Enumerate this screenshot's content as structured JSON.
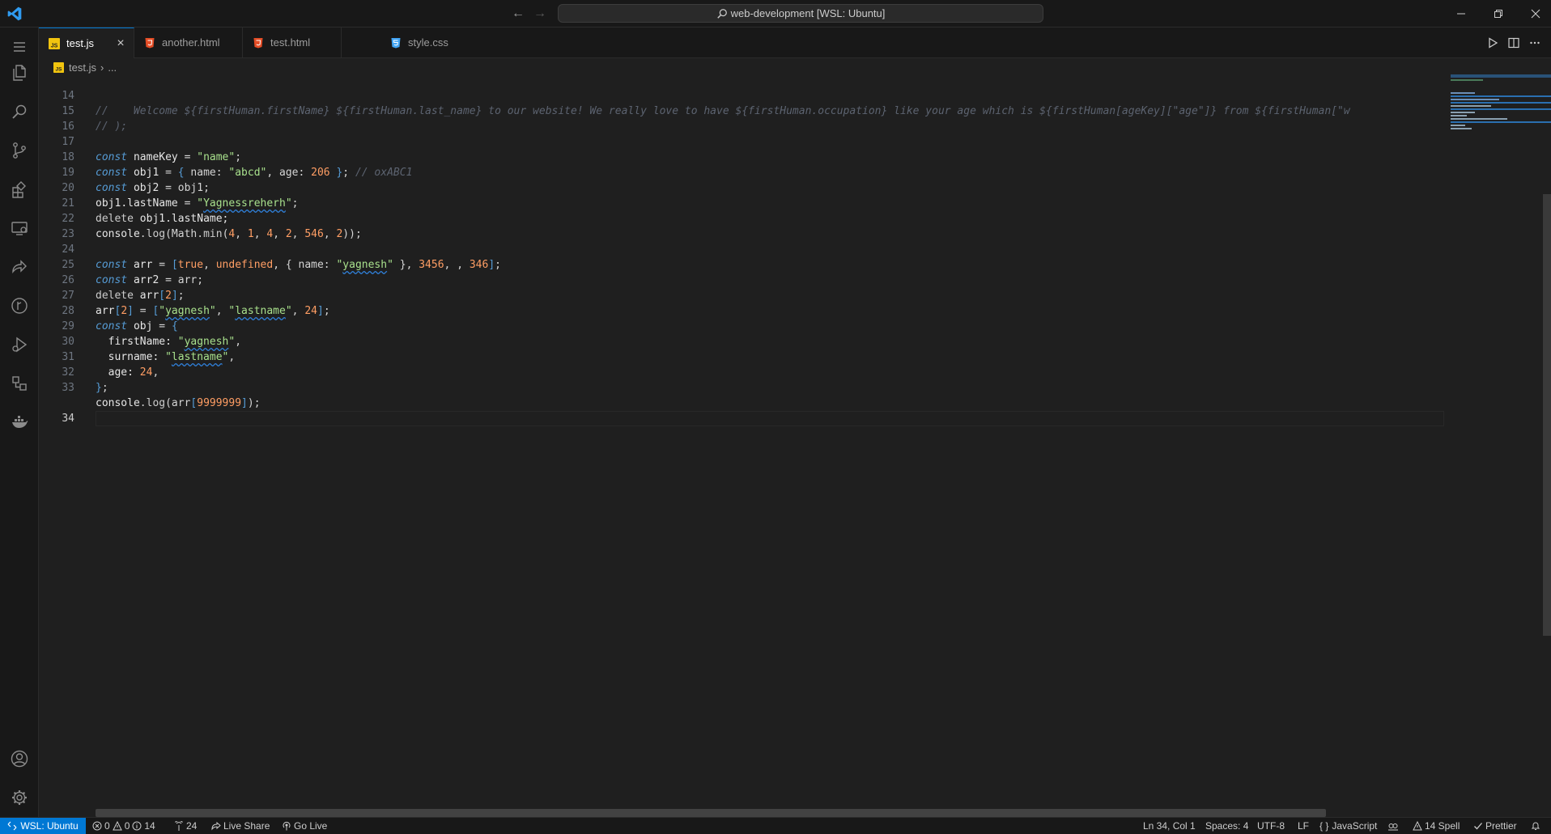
{
  "titlebar": {
    "search_text": "web-development [WSL: Ubuntu]"
  },
  "tabs": [
    {
      "label": "test.js",
      "icon": "js-file-icon",
      "active": true
    },
    {
      "label": "another.html",
      "icon": "html-file-icon",
      "active": false
    },
    {
      "label": "test.html",
      "icon": "html-file-icon",
      "active": false
    },
    {
      "label": "style.css",
      "icon": "css-file-icon",
      "active": false
    }
  ],
  "breadcrumb": {
    "file": "test.js",
    "rest": "..."
  },
  "editor": {
    "line_numbers": [
      "14",
      "15",
      "16",
      "17",
      "18",
      "19",
      "20",
      "21",
      "22",
      "23",
      "24",
      "25",
      "26",
      "27",
      "28",
      "29",
      "30",
      "31",
      "32",
      "33",
      "34"
    ],
    "current_line": "34",
    "line14_comment": "//    Welcome ${firstHuman.firstName} ${firstHuman.last_name} to our website! We really love to have ${firstHuman.occupation} like your age which is ${firstHuman[ageKey][\"age\"]} from ${firstHuman[\"w",
    "line15_comment": "// );",
    "line17": {
      "kw": "const",
      "name": "nameKey",
      "eq": " = ",
      "str": "\"name\"",
      "end": ";"
    },
    "line18": {
      "kw": "const",
      "name": "obj1",
      "a": " = ",
      "b1": "{",
      "p1": " name: ",
      "s1": "\"abcd\"",
      "c1": ", age: ",
      "n1": "206",
      "b2": " }",
      "e": "; ",
      "cmt": "// oxABC1"
    },
    "line19": {
      "kw": "const",
      "name": "obj2",
      "rest": " = obj1;"
    },
    "line20": {
      "a": "obj1",
      "b": ".lastName",
      "c": " = ",
      "q1": "\"",
      "s": "Yagnessreherh",
      "q2": "\"",
      "d": ";"
    },
    "line21": {
      "kw": "delete",
      "a": " obj1",
      "b": ".lastName;"
    },
    "line22": {
      "a": "console",
      "b": ".log",
      "c": "(Math",
      "d": ".min",
      "e": "(",
      "n1": "4",
      "f": ", ",
      "n2": "1",
      "g": ", ",
      "n3": "4",
      "h": ", ",
      "n4": "2",
      "i": ", ",
      "n5": "546",
      "j": ", ",
      "n6": "2",
      "k": "));"
    },
    "line24": {
      "kw": "const",
      "name": "arr",
      "a": " = ",
      "b1": "[",
      "t": "true",
      "c": ", ",
      "u": "undefined",
      "d": ", { name: ",
      "q1": "\"",
      "s": "yagnesh",
      "q2": "\"",
      "e": " }, ",
      "n1": "3456",
      "f": ", , ",
      "n2": "346",
      "b2": "]",
      "g": ";"
    },
    "line25": {
      "kw": "const",
      "name": "arr2",
      "rest": " = arr;"
    },
    "line26": {
      "kw": "delete",
      "a": " arr",
      "b1": "[",
      "n": "2",
      "b2": "]",
      "c": ";"
    },
    "line27": {
      "a": "arr",
      "b1": "[",
      "n": "2",
      "b2": "]",
      "c": " = ",
      "b3": "[",
      "q1": "\"",
      "s1": "yagnesh",
      "q2": "\"",
      "d": ", ",
      "q3": "\"",
      "s2": "lastname",
      "q4": "\"",
      "e": ", ",
      "n2": "24",
      "b4": "]",
      "f": ";"
    },
    "line28": {
      "kw": "const",
      "name": "obj",
      "a": " = ",
      "b": "{"
    },
    "line29": {
      "p": "  firstName: ",
      "q1": "\"",
      "s": "yagnesh",
      "q2": "\"",
      "c": ","
    },
    "line30": {
      "p": "  surname: ",
      "q1": "\"",
      "s": "lastname",
      "q2": "\"",
      "c": ","
    },
    "line31": {
      "p": "  age: ",
      "n": "24",
      "c": ","
    },
    "line32": {
      "b": "}",
      "c": ";"
    },
    "line33": {
      "a": "console",
      "b": ".log",
      "c": "(arr",
      "b1": "[",
      "n": "9999999",
      "b2": "]",
      "d": ");"
    }
  },
  "statusbar": {
    "remote": "WSL: Ubuntu",
    "errors": "0",
    "warnings": "0",
    "info": "14",
    "ports": "24",
    "live_share": "Live Share",
    "go_live": "Go Live",
    "position": "Ln 34, Col 1",
    "spaces": "Spaces: 4",
    "encoding": "UTF-8",
    "eol": "LF",
    "language": "JavaScript",
    "spell": "14 Spell",
    "prettier": "Prettier"
  },
  "colors": {
    "accent": "#0078d4",
    "js_icon": "#f1c40f",
    "html_icon": "#e44d26",
    "css_icon": "#42a5f5"
  }
}
